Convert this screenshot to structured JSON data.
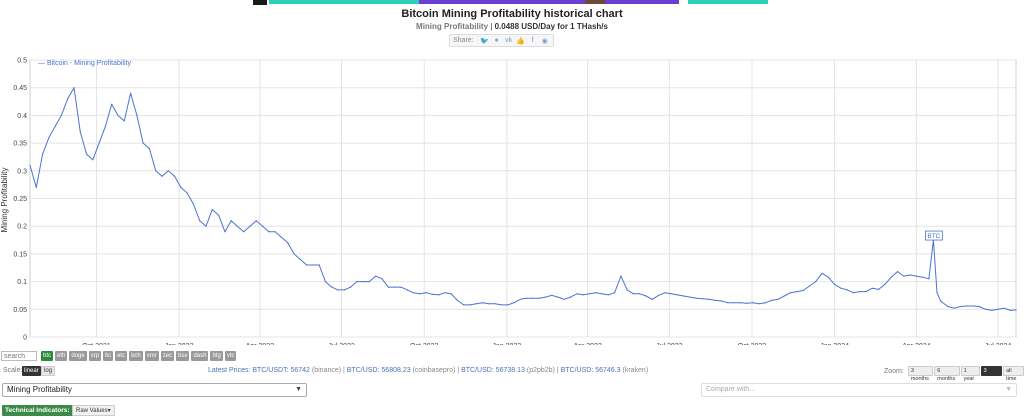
{
  "header": {
    "title": "Bitcoin Mining Profitability historical chart",
    "subtitle_label": "Mining Profitability",
    "subtitle_value": "0.0488 USD/Day for 1 THash/s",
    "share_label": "Share:"
  },
  "share_icons": [
    "twitter-icon",
    "reddit-icon",
    "vk-icon",
    "like-icon",
    "facebook-icon",
    "weibo-icon"
  ],
  "chart_data": {
    "type": "line",
    "legend": "— Bitcoin - Mining Profitability",
    "legend_position": "top-left",
    "xlabel": "",
    "ylabel": "Mining Profitability",
    "ylim": [
      0,
      0.5
    ],
    "y_ticks": [
      "0",
      "0.05",
      "0.1",
      "0.15",
      "0.2",
      "0.25",
      "0.3",
      "0.35",
      "0.4",
      "0.45",
      "0.5"
    ],
    "x_ticks": [
      "Oct 2021",
      "Jan 2022",
      "Apr 2022",
      "Jul 2022",
      "Oct 2022",
      "Jan 2023",
      "Apr 2023",
      "Jul 2023",
      "Oct 2023",
      "Jan 2024",
      "Apr 2024",
      "Jul 2024"
    ],
    "x_tick_dates": [
      "2021-10-01",
      "2022-01-01",
      "2022-04-01",
      "2022-07-01",
      "2022-10-01",
      "2023-01-01",
      "2023-04-01",
      "2023-07-01",
      "2023-10-01",
      "2024-01-01",
      "2024-04-01",
      "2024-07-01"
    ],
    "xlim": [
      "2021-07-19",
      "2024-07-21"
    ],
    "grid": true,
    "line_color": "#4a74d0",
    "annotation": {
      "label": "BTC",
      "date": "2024-04-20",
      "value": 0.175
    },
    "series": [
      {
        "name": "Bitcoin - Mining Profitability",
        "points": [
          [
            "2021-07-19",
            0.31
          ],
          [
            "2021-07-26",
            0.27
          ],
          [
            "2021-08-02",
            0.33
          ],
          [
            "2021-08-09",
            0.36
          ],
          [
            "2021-08-16",
            0.38
          ],
          [
            "2021-08-23",
            0.4
          ],
          [
            "2021-08-30",
            0.43
          ],
          [
            "2021-09-06",
            0.45
          ],
          [
            "2021-09-13",
            0.37
          ],
          [
            "2021-09-20",
            0.33
          ],
          [
            "2021-09-27",
            0.32
          ],
          [
            "2021-10-04",
            0.35
          ],
          [
            "2021-10-11",
            0.38
          ],
          [
            "2021-10-18",
            0.42
          ],
          [
            "2021-10-25",
            0.4
          ],
          [
            "2021-11-01",
            0.39
          ],
          [
            "2021-11-08",
            0.44
          ],
          [
            "2021-11-15",
            0.4
          ],
          [
            "2021-11-22",
            0.35
          ],
          [
            "2021-11-29",
            0.34
          ],
          [
            "2021-12-06",
            0.3
          ],
          [
            "2021-12-13",
            0.29
          ],
          [
            "2021-12-20",
            0.3
          ],
          [
            "2021-12-27",
            0.29
          ],
          [
            "2022-01-03",
            0.27
          ],
          [
            "2022-01-10",
            0.26
          ],
          [
            "2022-01-17",
            0.24
          ],
          [
            "2022-01-24",
            0.21
          ],
          [
            "2022-01-31",
            0.2
          ],
          [
            "2022-02-07",
            0.23
          ],
          [
            "2022-02-14",
            0.22
          ],
          [
            "2022-02-21",
            0.19
          ],
          [
            "2022-02-28",
            0.21
          ],
          [
            "2022-03-07",
            0.2
          ],
          [
            "2022-03-14",
            0.19
          ],
          [
            "2022-03-21",
            0.2
          ],
          [
            "2022-03-28",
            0.21
          ],
          [
            "2022-04-04",
            0.2
          ],
          [
            "2022-04-11",
            0.19
          ],
          [
            "2022-04-18",
            0.19
          ],
          [
            "2022-04-25",
            0.18
          ],
          [
            "2022-05-02",
            0.17
          ],
          [
            "2022-05-09",
            0.15
          ],
          [
            "2022-05-16",
            0.14
          ],
          [
            "2022-05-23",
            0.13
          ],
          [
            "2022-05-30",
            0.13
          ],
          [
            "2022-06-06",
            0.13
          ],
          [
            "2022-06-13",
            0.1
          ],
          [
            "2022-06-20",
            0.09
          ],
          [
            "2022-06-27",
            0.085
          ],
          [
            "2022-07-04",
            0.085
          ],
          [
            "2022-07-11",
            0.09
          ],
          [
            "2022-07-18",
            0.1
          ],
          [
            "2022-07-25",
            0.1
          ],
          [
            "2022-08-01",
            0.1
          ],
          [
            "2022-08-08",
            0.11
          ],
          [
            "2022-08-15",
            0.105
          ],
          [
            "2022-08-22",
            0.09
          ],
          [
            "2022-08-29",
            0.09
          ],
          [
            "2022-09-05",
            0.09
          ],
          [
            "2022-09-12",
            0.085
          ],
          [
            "2022-09-19",
            0.08
          ],
          [
            "2022-09-26",
            0.078
          ],
          [
            "2022-10-03",
            0.08
          ],
          [
            "2022-10-10",
            0.077
          ],
          [
            "2022-10-17",
            0.076
          ],
          [
            "2022-10-24",
            0.08
          ],
          [
            "2022-10-31",
            0.078
          ],
          [
            "2022-11-07",
            0.066
          ],
          [
            "2022-11-14",
            0.058
          ],
          [
            "2022-11-21",
            0.058
          ],
          [
            "2022-11-28",
            0.06
          ],
          [
            "2022-12-05",
            0.062
          ],
          [
            "2022-12-12",
            0.06
          ],
          [
            "2022-12-19",
            0.06
          ],
          [
            "2022-12-26",
            0.058
          ],
          [
            "2023-01-02",
            0.058
          ],
          [
            "2023-01-09",
            0.062
          ],
          [
            "2023-01-16",
            0.068
          ],
          [
            "2023-01-23",
            0.07
          ],
          [
            "2023-01-30",
            0.07
          ],
          [
            "2023-02-06",
            0.07
          ],
          [
            "2023-02-13",
            0.072
          ],
          [
            "2023-02-20",
            0.075
          ],
          [
            "2023-02-27",
            0.072
          ],
          [
            "2023-03-06",
            0.068
          ],
          [
            "2023-03-13",
            0.072
          ],
          [
            "2023-03-20",
            0.078
          ],
          [
            "2023-03-27",
            0.076
          ],
          [
            "2023-04-03",
            0.078
          ],
          [
            "2023-04-10",
            0.08
          ],
          [
            "2023-04-17",
            0.078
          ],
          [
            "2023-04-24",
            0.076
          ],
          [
            "2023-05-01",
            0.08
          ],
          [
            "2023-05-08",
            0.11
          ],
          [
            "2023-05-15",
            0.085
          ],
          [
            "2023-05-22",
            0.078
          ],
          [
            "2023-05-29",
            0.078
          ],
          [
            "2023-06-05",
            0.074
          ],
          [
            "2023-06-12",
            0.068
          ],
          [
            "2023-06-19",
            0.075
          ],
          [
            "2023-06-26",
            0.08
          ],
          [
            "2023-07-03",
            0.078
          ],
          [
            "2023-07-10",
            0.076
          ],
          [
            "2023-07-17",
            0.074
          ],
          [
            "2023-07-24",
            0.072
          ],
          [
            "2023-07-31",
            0.07
          ],
          [
            "2023-08-07",
            0.069
          ],
          [
            "2023-08-14",
            0.068
          ],
          [
            "2023-08-21",
            0.066
          ],
          [
            "2023-08-28",
            0.065
          ],
          [
            "2023-09-04",
            0.062
          ],
          [
            "2023-09-11",
            0.062
          ],
          [
            "2023-09-18",
            0.062
          ],
          [
            "2023-09-25",
            0.061
          ],
          [
            "2023-10-02",
            0.062
          ],
          [
            "2023-10-09",
            0.06
          ],
          [
            "2023-10-16",
            0.062
          ],
          [
            "2023-10-23",
            0.066
          ],
          [
            "2023-10-30",
            0.068
          ],
          [
            "2023-11-06",
            0.074
          ],
          [
            "2023-11-13",
            0.08
          ],
          [
            "2023-11-20",
            0.082
          ],
          [
            "2023-11-27",
            0.084
          ],
          [
            "2023-12-04",
            0.092
          ],
          [
            "2023-12-11",
            0.1
          ],
          [
            "2023-12-18",
            0.115
          ],
          [
            "2023-12-25",
            0.108
          ],
          [
            "2024-01-01",
            0.095
          ],
          [
            "2024-01-08",
            0.088
          ],
          [
            "2024-01-15",
            0.085
          ],
          [
            "2024-01-22",
            0.08
          ],
          [
            "2024-01-29",
            0.082
          ],
          [
            "2024-02-05",
            0.082
          ],
          [
            "2024-02-12",
            0.088
          ],
          [
            "2024-02-19",
            0.086
          ],
          [
            "2024-02-26",
            0.095
          ],
          [
            "2024-03-04",
            0.108
          ],
          [
            "2024-03-11",
            0.118
          ],
          [
            "2024-03-18",
            0.11
          ],
          [
            "2024-03-25",
            0.112
          ],
          [
            "2024-04-01",
            0.11
          ],
          [
            "2024-04-08",
            0.108
          ],
          [
            "2024-04-15",
            0.105
          ],
          [
            "2024-04-20",
            0.175
          ],
          [
            "2024-04-24",
            0.08
          ],
          [
            "2024-04-28",
            0.065
          ],
          [
            "2024-05-06",
            0.055
          ],
          [
            "2024-05-13",
            0.052
          ],
          [
            "2024-05-20",
            0.055
          ],
          [
            "2024-05-27",
            0.056
          ],
          [
            "2024-06-03",
            0.056
          ],
          [
            "2024-06-10",
            0.055
          ],
          [
            "2024-06-17",
            0.05
          ],
          [
            "2024-06-24",
            0.048
          ],
          [
            "2024-07-01",
            0.05
          ],
          [
            "2024-07-08",
            0.052
          ],
          [
            "2024-07-15",
            0.048
          ],
          [
            "2024-07-21",
            0.049
          ]
        ]
      }
    ]
  },
  "coins": {
    "search_placeholder": "search",
    "items": [
      {
        "label": "btc",
        "active": true
      },
      {
        "label": "eth",
        "active": false
      },
      {
        "label": "doge",
        "active": false
      },
      {
        "label": "xrp",
        "active": false
      },
      {
        "label": "ltc",
        "active": false
      },
      {
        "label": "etc",
        "active": false
      },
      {
        "label": "bch",
        "active": false
      },
      {
        "label": "xmr",
        "active": false
      },
      {
        "label": "zec",
        "active": false
      },
      {
        "label": "bsv",
        "active": false
      },
      {
        "label": "dash",
        "active": false
      },
      {
        "label": "btg",
        "active": false
      },
      {
        "label": "vtc",
        "active": false
      }
    ]
  },
  "scale": {
    "label": "Scale:",
    "linear": "linear",
    "log": "log"
  },
  "prices": {
    "label": "Latest Prices:",
    "items": [
      {
        "pair": "BTC/USDT: 56742",
        "exchange": "(binance)"
      },
      {
        "pair": "BTC/USD: 56808.23",
        "exchange": "(coinbasepro)"
      },
      {
        "pair": "BTC/USD: 56738.13",
        "exchange": "(p2pb2b)"
      },
      {
        "pair": "BTC/USD: 56746.3",
        "exchange": "(kraken)"
      }
    ]
  },
  "zoom": {
    "label": "Zoom:",
    "options": [
      {
        "label": "3 months",
        "active": false
      },
      {
        "label": "6 months",
        "active": false
      },
      {
        "label": "1 year",
        "active": false
      },
      {
        "label": "3 years",
        "active": true
      },
      {
        "label": "all time",
        "active": false
      }
    ]
  },
  "selects": {
    "metric": "Mining Profitability",
    "compare_placeholder": "Compare with..."
  },
  "indicators": {
    "label": "Technical Indicators:",
    "raw_values": "Raw Values"
  }
}
